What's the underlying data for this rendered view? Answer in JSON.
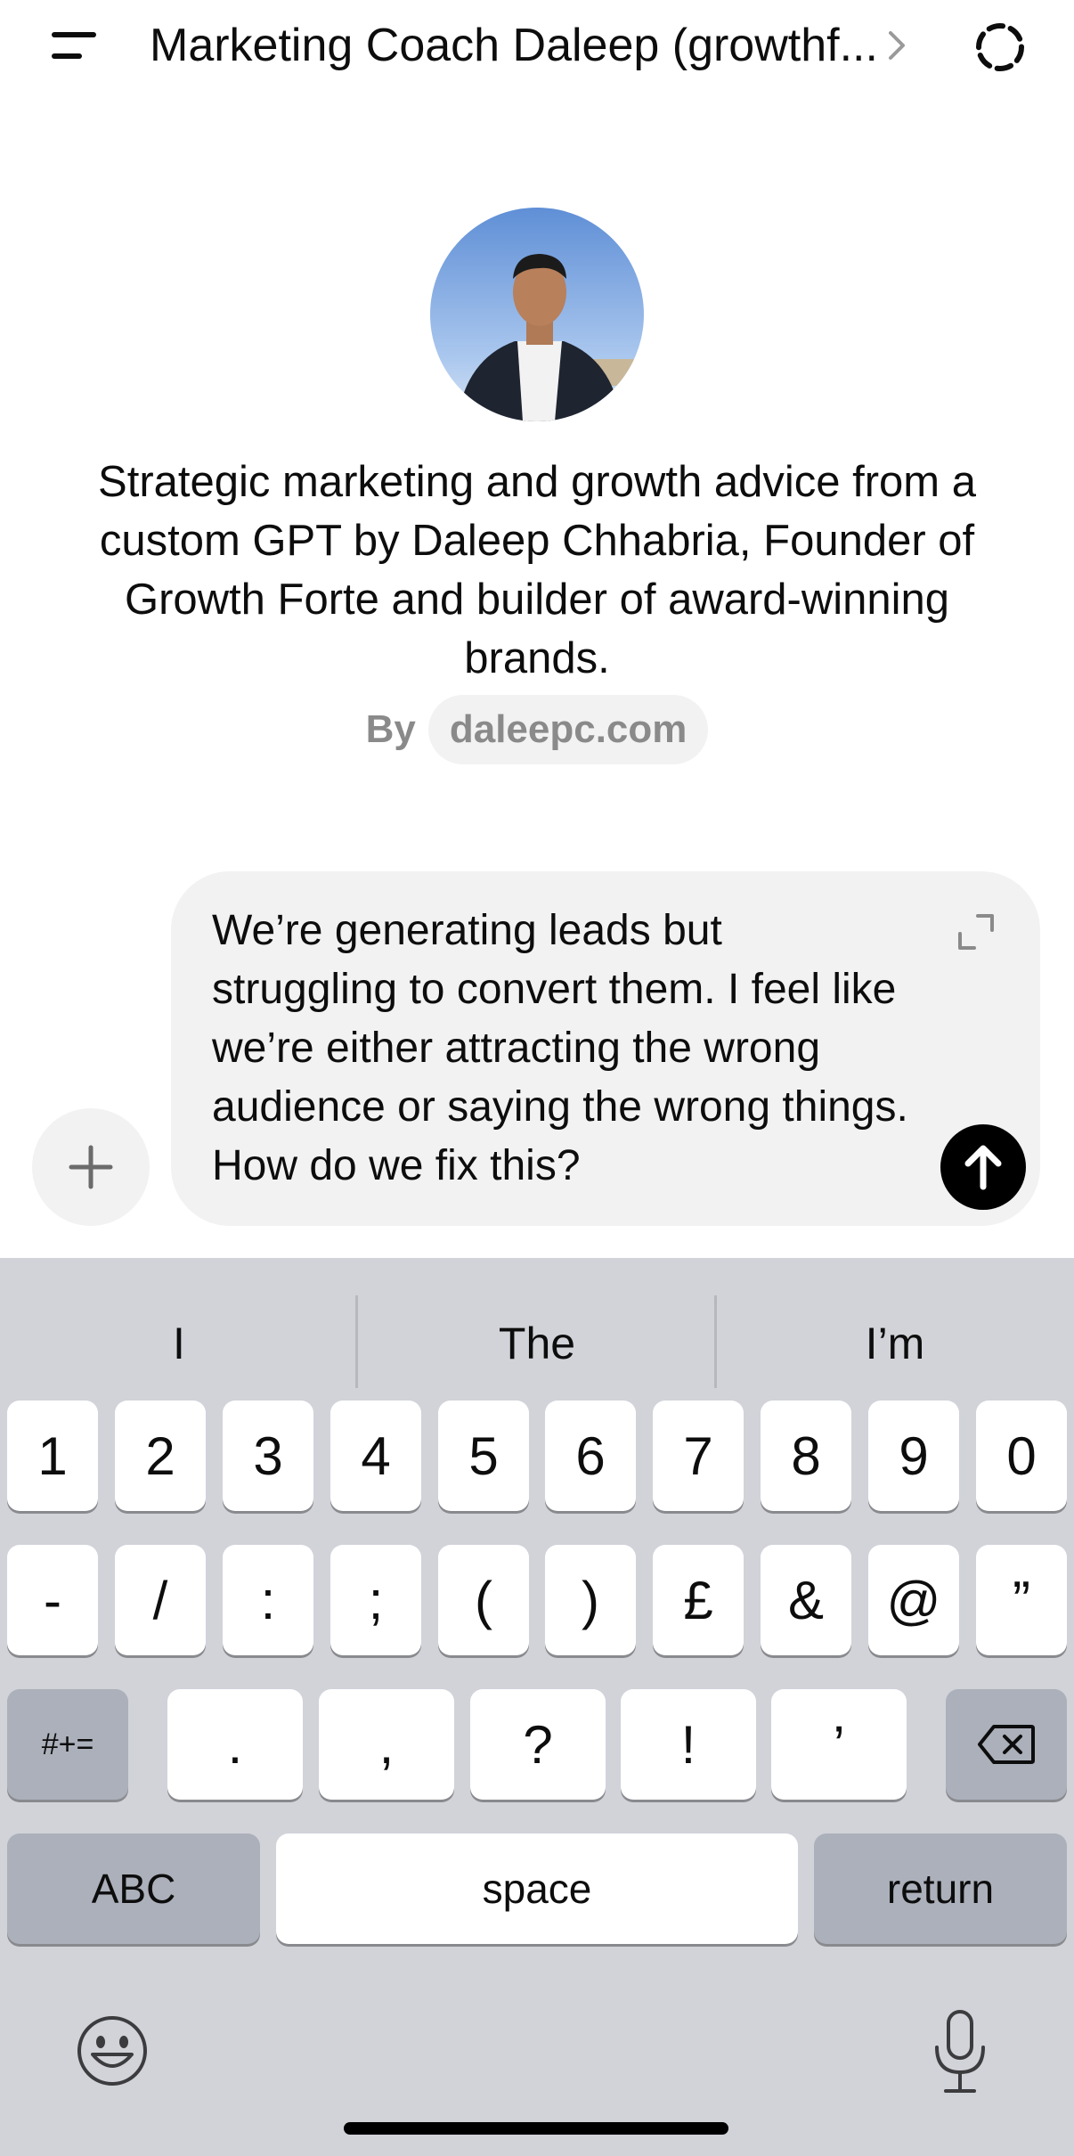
{
  "header": {
    "title": "Marketing Coach Daleep (growthf..."
  },
  "gpt": {
    "description": "Strategic marketing and growth advice from a custom GPT by Daleep Chhabria, Founder of Growth Forte and builder of award-winning brands.",
    "by_label": "By",
    "by_link": "daleepc.com"
  },
  "composer": {
    "message": "We’re generating leads but struggling to convert them. I feel like we’re either attracting the wrong audience or saying the wrong things. How do we fix this?"
  },
  "keyboard": {
    "suggestions": [
      "I",
      "The",
      "I’m"
    ],
    "row1": [
      "1",
      "2",
      "3",
      "4",
      "5",
      "6",
      "7",
      "8",
      "9",
      "0"
    ],
    "row2": [
      "-",
      "/",
      ":",
      ";",
      "(",
      ")",
      "£",
      "&",
      "@",
      "”"
    ],
    "row3": [
      ".",
      ",",
      "?",
      "!",
      "’"
    ],
    "symbols_key": "#+=",
    "abc_key": "ABC",
    "space_key": "space",
    "return_key": "return"
  },
  "icons": [
    "menu-icon",
    "chevron-right-icon",
    "temporary-chat-icon",
    "plus-icon",
    "expand-icon",
    "arrow-up-icon",
    "backspace-icon",
    "emoji-icon",
    "microphone-icon"
  ],
  "colors": {
    "send_button": "#000000",
    "keyboard_bg": "#d1d3d9",
    "composer_bg": "#f2f2f2"
  }
}
